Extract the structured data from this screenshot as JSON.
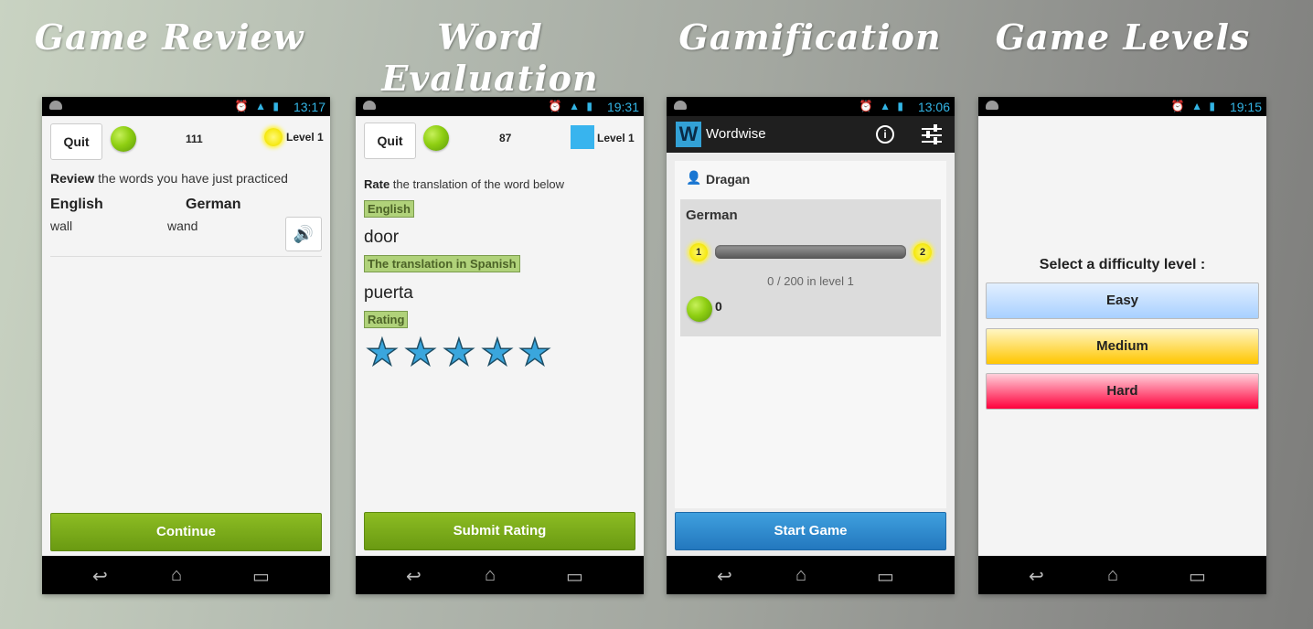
{
  "captions": [
    "Game Review",
    "Word Evaluation",
    "Gamification",
    "Game Levels"
  ],
  "screen1": {
    "time": "13:17",
    "quit": "Quit",
    "score": "111",
    "level": "Level 1",
    "review_bold": "Review",
    "review_rest": " the words you have just practiced",
    "col1": "English",
    "col2": "German",
    "word1": "wall",
    "word2": "wand",
    "continue": "Continue"
  },
  "screen2": {
    "time": "19:31",
    "quit": "Quit",
    "score": "87",
    "level": "Level 1",
    "rate_bold": "Rate",
    "rate_rest": " the translation of the word below",
    "tag_english": "English",
    "word": "door",
    "tag_translation": "The translation in Spanish",
    "translation": "puerta",
    "tag_rating": "Rating",
    "stars": 5,
    "submit": "Submit Rating"
  },
  "screen3": {
    "time": "13:06",
    "app_name": "Wordwise",
    "user": "Dragan",
    "language": "German",
    "level_from": "1",
    "level_to": "2",
    "progress_text": "0 / 200 in level 1",
    "progress": 0,
    "coins": "0",
    "start": "Start Game"
  },
  "screen4": {
    "time": "19:15",
    "prompt": "Select a difficulty level :",
    "easy": "Easy",
    "medium": "Medium",
    "hard": "Hard"
  },
  "colors": {
    "accent_blue": "#33b5e5",
    "green": "#7aaa1a",
    "easy": "#bcdcff",
    "medium": "#ffd21a",
    "hard": "#ff1f4f"
  }
}
